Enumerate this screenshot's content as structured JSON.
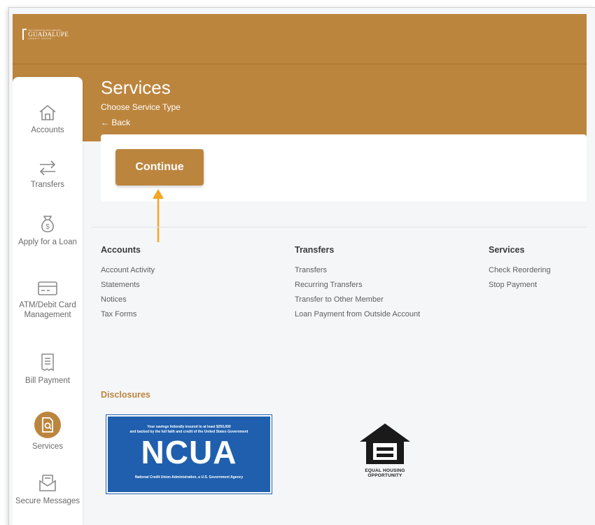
{
  "brand": {
    "logo_name": "GUADALUPE",
    "logo_top_line": "Your community and a Member",
    "logo_sub": "CREDIT UNION",
    "primary_color": "#bc853e"
  },
  "header": {
    "title": "Services",
    "subtitle": "Choose Service Type",
    "back_label": "← Back"
  },
  "sidebar": {
    "items": [
      {
        "label": "Accounts",
        "icon": "home-icon"
      },
      {
        "label": "Transfers",
        "icon": "transfer-arrows-icon"
      },
      {
        "label": "Apply for a Loan",
        "icon": "money-bag-icon"
      },
      {
        "label": "ATM/Debit Card Management",
        "icon": "card-icon"
      },
      {
        "label": "Bill Payment",
        "icon": "bill-icon"
      },
      {
        "label": "Services",
        "icon": "services-icon",
        "active": true
      },
      {
        "label": "Secure Messages",
        "icon": "message-icon"
      }
    ]
  },
  "main": {
    "continue_label": "Continue",
    "annotation_arrow_color": "#f5a623"
  },
  "footer_links": {
    "accounts": {
      "heading": "Accounts",
      "links": [
        "Account Activity",
        "Statements",
        "Notices",
        "Tax Forms"
      ]
    },
    "transfers": {
      "heading": "Transfers",
      "links": [
        "Transfers",
        "Recurring Transfers",
        "Transfer to Other Member",
        "Loan Payment from Outside Account"
      ]
    },
    "services": {
      "heading": "Services",
      "links": [
        "Check Reordering",
        "Stop Payment"
      ]
    }
  },
  "disclosures": {
    "heading": "Disclosures",
    "ncua": {
      "line1": "Your savings federally insured to at least $250,000",
      "line2": "and backed by the full faith and credit of the United States Government",
      "big": "NCUA",
      "line3": "National Credit Union Administration, a U.S. Government Agency"
    },
    "eho": {
      "line1": "EQUAL HOUSING",
      "line2": "OPPORTUNITY"
    }
  }
}
